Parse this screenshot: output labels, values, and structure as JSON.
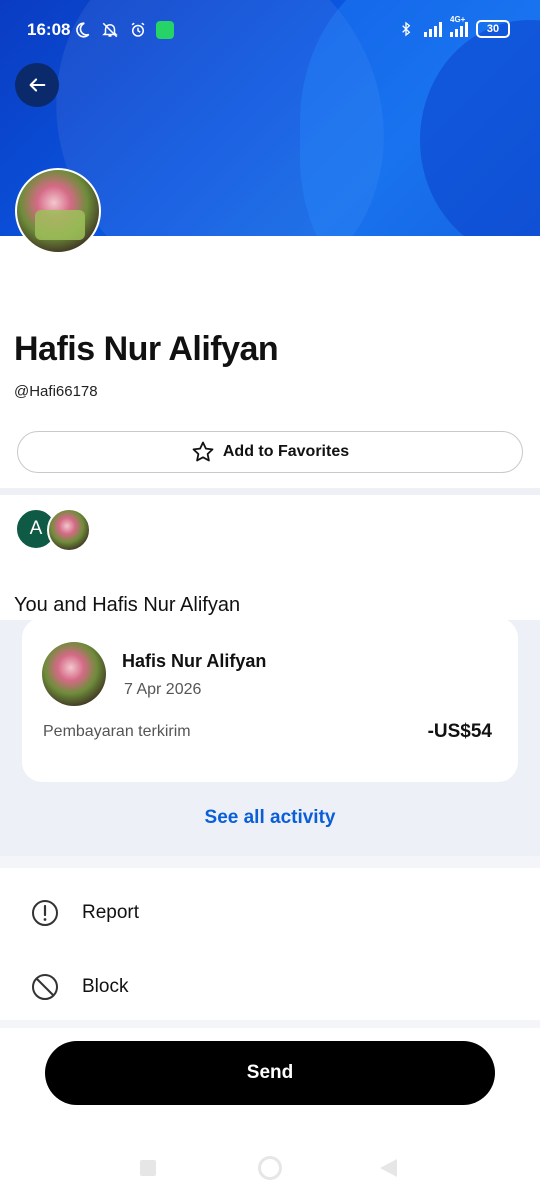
{
  "status_bar": {
    "time": "16:08",
    "network": "4G+",
    "battery": "30"
  },
  "profile": {
    "name": "Hafis Nur Alifyan",
    "handle": "@Hafi66178",
    "mini_avatar_initial": "A",
    "favorites_label": "Add to Favorites"
  },
  "activity": {
    "heading": "You and Hafis Nur Alifyan",
    "card": {
      "name": "Hafis Nur Alifyan",
      "date": "7 Apr 2026",
      "description": "Pembayaran terkirim",
      "amount": "-US$54"
    },
    "see_all_label": "See all activity"
  },
  "menu": {
    "report_label": "Report",
    "block_label": "Block"
  },
  "send_label": "Send",
  "colors": {
    "banner": "#0b56e0",
    "link": "#0a5fd8",
    "send_bg": "#000000"
  }
}
